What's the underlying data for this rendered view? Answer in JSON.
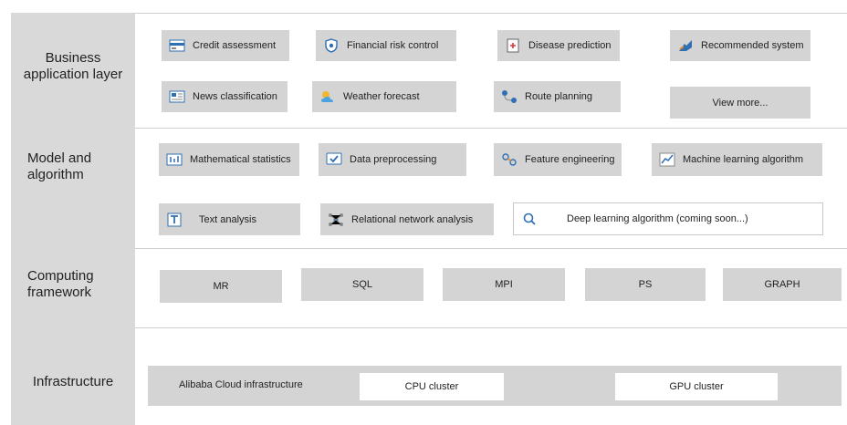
{
  "layers": {
    "business": "Business\napplication layer",
    "model": "Model and\nalgorithm",
    "computing": "Computing\nframework",
    "infrastructure": "Infrastructure"
  },
  "business_items": [
    {
      "label": "Credit assessment",
      "icon": "card-icon"
    },
    {
      "label": "Financial risk control",
      "icon": "shield-icon"
    },
    {
      "label": "Disease prediction",
      "icon": "medical-icon"
    },
    {
      "label": "Recommended system",
      "icon": "thumbs-up-icon"
    },
    {
      "label": "News classification",
      "icon": "newspaper-icon"
    },
    {
      "label": "Weather forecast",
      "icon": "weather-icon"
    },
    {
      "label": "Route planning",
      "icon": "route-icon"
    },
    {
      "label": "View more..."
    }
  ],
  "model_items": [
    {
      "label": "Mathematical statistics",
      "icon": "statistics-icon"
    },
    {
      "label": "Data preprocessing",
      "icon": "check-monitor-icon"
    },
    {
      "label": "Feature engineering",
      "icon": "feature-icon"
    },
    {
      "label": "Machine learning algorithm",
      "icon": "chart-icon"
    },
    {
      "label": "Text analysis",
      "icon": "text-icon"
    },
    {
      "label": "Relational network analysis",
      "icon": "network-icon"
    },
    {
      "label": "Deep learning algorithm (coming soon...)",
      "icon": "search-icon"
    }
  ],
  "computing_items": [
    "MR",
    "SQL",
    "MPI",
    "PS",
    "GRAPH"
  ],
  "infrastructure": {
    "platform": "Alibaba Cloud infrastructure",
    "cpu": "CPU cluster",
    "gpu": "GPU cluster"
  },
  "colors": {
    "box": "#d4d4d4",
    "panel": "#d9d9d9",
    "icon_blue": "#2f6fb3",
    "icon_orange": "#e08a2e",
    "icon_green": "#3a9a4a"
  }
}
